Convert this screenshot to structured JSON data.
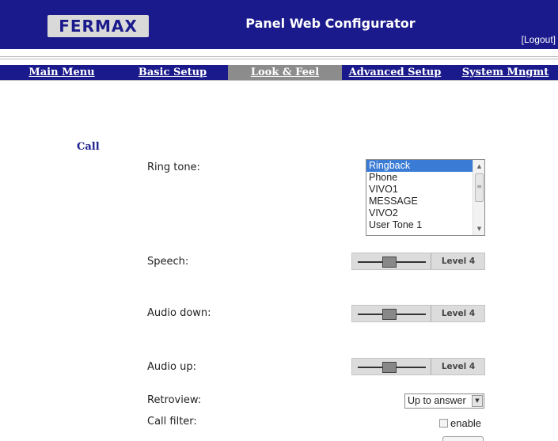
{
  "header": {
    "logo_text": "FERMAX",
    "title": "Panel Web Configurator",
    "logout_label": "[Logout]"
  },
  "nav": {
    "tabs": [
      {
        "label": "Main Menu",
        "active": false
      },
      {
        "label": "Basic Setup",
        "active": false
      },
      {
        "label": "Look & Feel",
        "active": true
      },
      {
        "label": "Advanced Setup",
        "active": false
      },
      {
        "label": "System Mngmt",
        "active": false
      }
    ]
  },
  "call": {
    "section_title": "Call",
    "ring_tone": {
      "label": "Ring tone:",
      "options": [
        "Ringback",
        "Phone",
        "VIVO1",
        "MESSAGE",
        "VIVO2",
        "User Tone 1"
      ],
      "selected": "Ringback"
    },
    "speech": {
      "label": "Speech:",
      "level_label": "Level 4",
      "level": 4
    },
    "audio_down": {
      "label": "Audio down:",
      "level_label": "Level 4",
      "level": 4
    },
    "audio_up": {
      "label": "Audio up:",
      "level_label": "Level 4",
      "level": 4
    },
    "retroview": {
      "label": "Retroview:",
      "value": "Up to answer"
    },
    "call_filter": {
      "label": "Call filter:",
      "checkbox_label": "enable",
      "checked": false
    }
  },
  "colors": {
    "header_bg": "#1a1a8c",
    "nav_active_bg": "#8c8c8c",
    "selection": "#3a7bd5"
  }
}
